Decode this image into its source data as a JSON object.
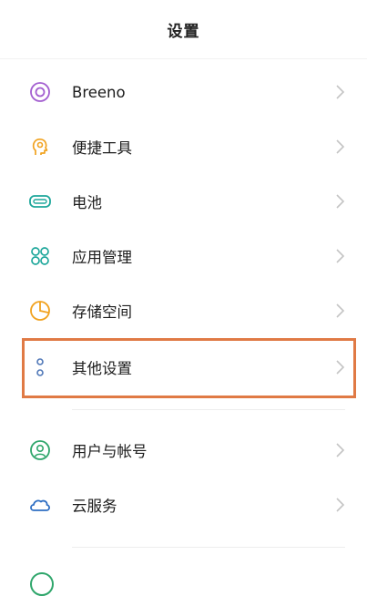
{
  "header": {
    "title": "设置"
  },
  "items": [
    {
      "label": "Breeno",
      "icon": "breeno-icon",
      "color": "#a35fd0"
    },
    {
      "label": "便捷工具",
      "icon": "convenience-tools-icon",
      "color": "#f1a21f"
    },
    {
      "label": "电池",
      "icon": "battery-icon",
      "color": "#1ea79b"
    },
    {
      "label": "应用管理",
      "icon": "app-management-icon",
      "color": "#1ea79b"
    },
    {
      "label": "存储空间",
      "icon": "storage-icon",
      "color": "#f1a21f"
    },
    {
      "label": "其他设置",
      "icon": "other-settings-icon",
      "color": "#5078b8"
    },
    {
      "label": "用户与帐号",
      "icon": "user-account-icon",
      "color": "#2fa66b"
    },
    {
      "label": "云服务",
      "icon": "cloud-service-icon",
      "color": "#2f6fc3"
    }
  ],
  "highlight_color": "#e07a45"
}
